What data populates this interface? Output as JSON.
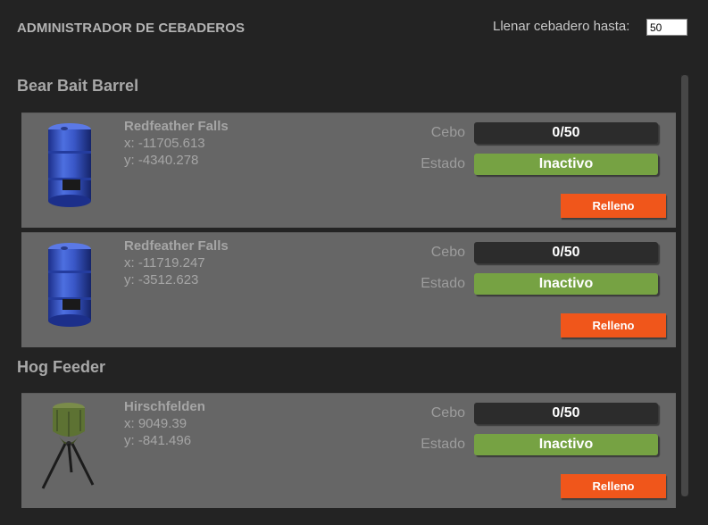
{
  "header": {
    "title": "ADMINISTRADOR DE CEBADEROS",
    "fill_label": "Llenar cebadero hasta:",
    "fill_value": "50"
  },
  "sections": [
    {
      "title": "Bear Bait Barrel",
      "icon": "blue-barrel-icon",
      "items": [
        {
          "name": "Redfeather Falls",
          "x": "x: -11705.613",
          "y": "y: -4340.278",
          "bait_label": "Cebo",
          "bait_value": "0/50",
          "status_label": "Estado",
          "status_value": "Inactivo",
          "refill_label": "Relleno"
        },
        {
          "name": "Redfeather Falls",
          "x": "x: -11719.247",
          "y": "y: -3512.623",
          "bait_label": "Cebo",
          "bait_value": "0/50",
          "status_label": "Estado",
          "status_value": "Inactivo",
          "refill_label": "Relleno"
        }
      ]
    },
    {
      "title": "Hog Feeder",
      "icon": "tripod-feeder-icon",
      "items": [
        {
          "name": "Hirschfelden",
          "x": "x: 9049.39",
          "y": "y: -841.496",
          "bait_label": "Cebo",
          "bait_value": "0/50",
          "status_label": "Estado",
          "status_value": "Inactivo",
          "refill_label": "Relleno"
        }
      ]
    }
  ],
  "colors": {
    "background": "#232323",
    "card": "#666666",
    "status_inactive": "#76a243",
    "refill_button": "#f0561b",
    "bait_box": "#2c2c2c"
  }
}
